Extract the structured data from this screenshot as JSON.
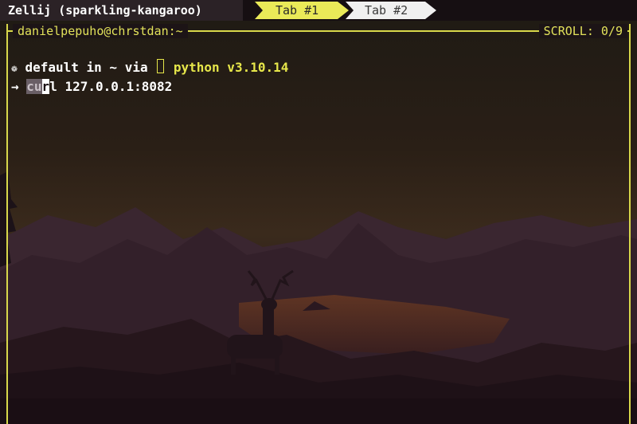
{
  "session": {
    "title": "Zellij (sparkling-kangaroo)"
  },
  "tabs": [
    {
      "label": "Tab #1",
      "active": true
    },
    {
      "label": "Tab #2",
      "active": false
    }
  ],
  "pane": {
    "name": "danielpepuho@chrstdan:~",
    "scroll_label": "SCROLL:",
    "scroll_value": "0/9"
  },
  "terminal": {
    "prompt": {
      "icon": "gear-icon",
      "context": "default in ~ via",
      "lang_icon": "python-icon",
      "lang": "python v3.10.14"
    },
    "command": {
      "arrow": "→",
      "typed_before_cursor": "cu",
      "cursor_char": "r",
      "typed_after_cursor": "l 127.0.0.1:8082"
    }
  },
  "colors": {
    "accent_yellow": "#e6e64a",
    "frame": "#d8d84a",
    "session_bg": "#2b2226",
    "tab_active_bg": "#eaea58",
    "tab_inactive_bg": "#f0f0f0"
  }
}
